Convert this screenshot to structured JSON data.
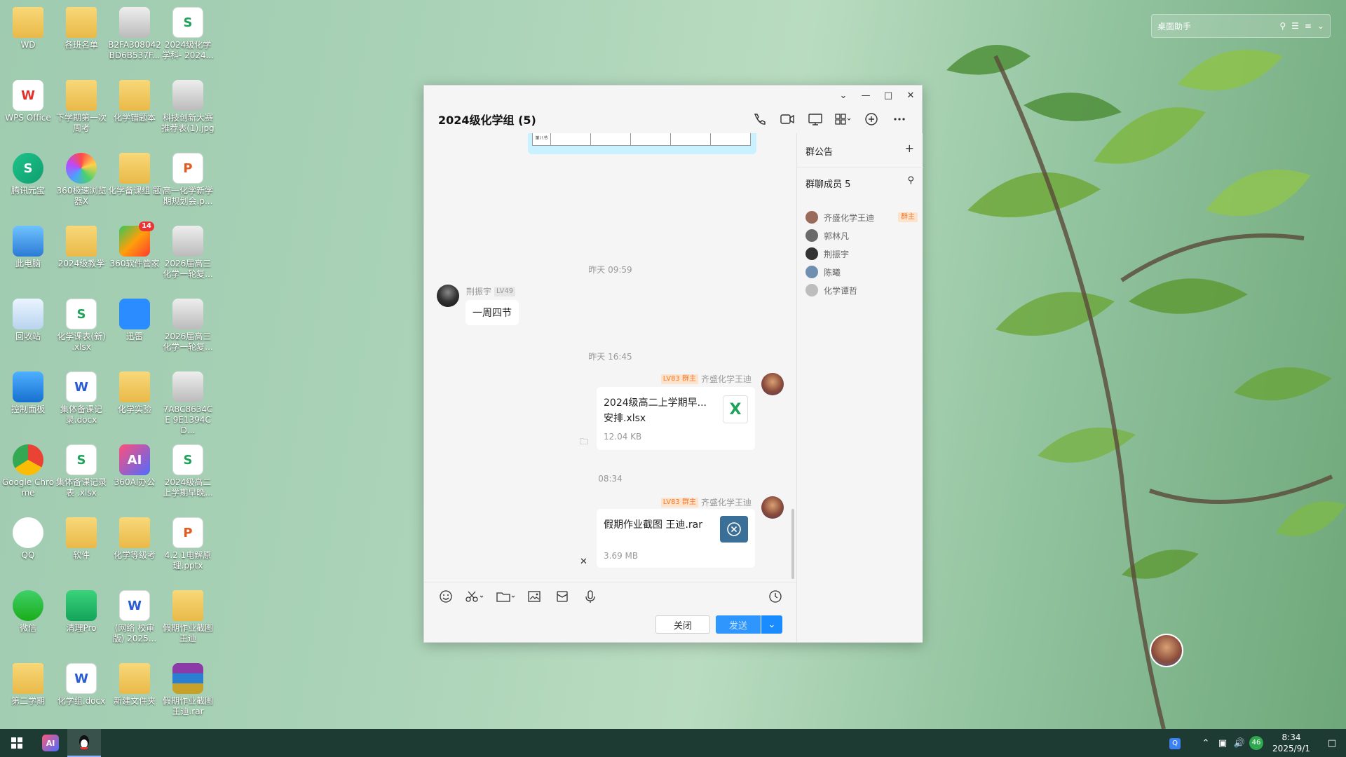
{
  "desktop": {
    "icons": [
      {
        "label": "WD",
        "glyph": "",
        "kind": "folder"
      },
      {
        "label": "各班名单",
        "glyph": "",
        "kind": "folder"
      },
      {
        "label": "B2FA308042 BD6B537F...",
        "glyph": "",
        "kind": "img"
      },
      {
        "label": "2024级化学 学科- 2024...",
        "glyph": "S",
        "kind": "xls"
      },
      {
        "label": "WPS Office",
        "glyph": "W",
        "kind": "wps"
      },
      {
        "label": "下学期第一次 周考",
        "glyph": "",
        "kind": "folder"
      },
      {
        "label": "化学错题本",
        "glyph": "",
        "kind": "folder"
      },
      {
        "label": "科技创新大赛 推荐表(1).jpg",
        "glyph": "",
        "kind": "img"
      },
      {
        "label": "腾讯元宝",
        "glyph": "S",
        "kind": "yuanbao"
      },
      {
        "label": "360极速浏览 器X",
        "glyph": "",
        "kind": "browser360"
      },
      {
        "label": "化学备课组 题",
        "glyph": "",
        "kind": "folder"
      },
      {
        "label": "高一化学新学 期规划会.p...",
        "glyph": "P",
        "kind": "ppt"
      },
      {
        "label": "此电脑",
        "glyph": "",
        "kind": "pc"
      },
      {
        "label": "2024级教学",
        "glyph": "",
        "kind": "folder"
      },
      {
        "label": "360软件管家",
        "glyph": "",
        "kind": "soft360",
        "badge": "14"
      },
      {
        "label": "2026届高三 化学一轮复...",
        "glyph": "",
        "kind": "img"
      },
      {
        "label": "回收站",
        "glyph": "",
        "kind": "bin"
      },
      {
        "label": "化学课表(新) .xlsx",
        "glyph": "S",
        "kind": "xls"
      },
      {
        "label": "迅雷",
        "glyph": "",
        "kind": "xunlei"
      },
      {
        "label": "2026届高三 化学一轮复...",
        "glyph": "",
        "kind": "img"
      },
      {
        "label": "控制面板",
        "glyph": "",
        "kind": "panel"
      },
      {
        "label": "集体备课记 录.docx",
        "glyph": "W",
        "kind": "doc"
      },
      {
        "label": "化学实验",
        "glyph": "",
        "kind": "folder"
      },
      {
        "label": "7A8C8634CE 9E1394CD...",
        "glyph": "",
        "kind": "img"
      },
      {
        "label": "Google Chrome",
        "glyph": "",
        "kind": "chrome"
      },
      {
        "label": "集体备课记录 表 .xlsx",
        "glyph": "S",
        "kind": "xls"
      },
      {
        "label": "360AI办公",
        "glyph": "AI",
        "kind": "ai360"
      },
      {
        "label": "2024级高二 上学期早晚...",
        "glyph": "S",
        "kind": "xls"
      },
      {
        "label": "QQ",
        "glyph": "",
        "kind": "qq"
      },
      {
        "label": "软件",
        "glyph": "",
        "kind": "folder"
      },
      {
        "label": "化学等级考",
        "glyph": "",
        "kind": "folder"
      },
      {
        "label": "4.2.1电解原 理.pptx",
        "glyph": "P",
        "kind": "ppt"
      },
      {
        "label": "微信",
        "glyph": "",
        "kind": "wechat"
      },
      {
        "label": "清理Pro",
        "glyph": "",
        "kind": "cleanpro"
      },
      {
        "label": "(网络 校审 版) 2025...",
        "glyph": "W",
        "kind": "doc"
      },
      {
        "label": "假期作业截图 王迪",
        "glyph": "",
        "kind": "folder"
      },
      {
        "label": "第二学期",
        "glyph": "",
        "kind": "folder"
      },
      {
        "label": "化学组.docx",
        "glyph": "W",
        "kind": "doc"
      },
      {
        "label": "新建文件夹",
        "glyph": "",
        "kind": "folder"
      },
      {
        "label": "假期作业截图 王迪.rar",
        "glyph": "",
        "kind": "rar"
      }
    ],
    "assistant": {
      "title": "桌面助手"
    }
  },
  "chat": {
    "title": "2024级化学组 (5)",
    "messages": {
      "ts1": "昨天 09:59",
      "m1_sender": "荆振宇",
      "m1_level": "LV49",
      "m1_text": "一周四节",
      "ts2": "昨天 16:45",
      "m2_level": "LV83",
      "m2_role": "群主",
      "m2_sender": "齐盛化学王迪",
      "m2_file": "2024级高二上学期早...安排.xlsx",
      "m2_size": "12.04 KB",
      "ts3": "08:34",
      "m3_level": "LV83",
      "m3_role": "群主",
      "m3_sender": "齐盛化学王迪",
      "m3_file": "假期作业截图 王迪.rar",
      "m3_size": "3.69 MB",
      "table_cell": "第八节"
    },
    "close_label": "关闭",
    "send_label": "发送",
    "side": {
      "notice_title": "群公告",
      "members_title": "群聊成员 5",
      "members": [
        {
          "name": "齐盛化学王迪",
          "tag": "群主",
          "color": "#9a6b5a"
        },
        {
          "name": "郭林凡",
          "tag": "",
          "color": "#6a6a6a"
        },
        {
          "name": "荆振宇",
          "tag": "",
          "color": "#333333"
        },
        {
          "name": "陈曦",
          "tag": "",
          "color": "#6f8fb0"
        },
        {
          "name": "化学谭哲",
          "tag": "",
          "color": "#bdbdbd"
        }
      ]
    }
  },
  "taskbar": {
    "time": "8:34",
    "date": "2025/9/1",
    "network_badge": "46"
  },
  "colors": {
    "accent": "#1a8cff",
    "owner_tag_bg": "#fde2cc",
    "owner_tag_fg": "#f37b2a",
    "taskbar": "#1e3b33"
  }
}
